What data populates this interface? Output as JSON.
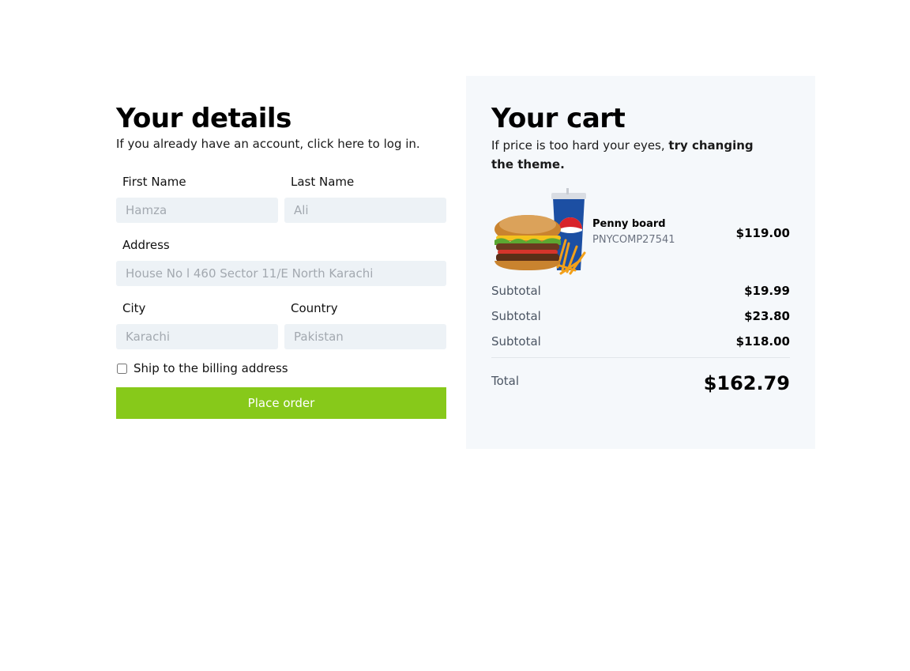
{
  "details": {
    "title": "Your details",
    "subtitle": "If you already have an account, click here to log in.",
    "first_name": {
      "label": "First Name",
      "placeholder": "Hamza"
    },
    "last_name": {
      "label": "Last Name",
      "placeholder": "Ali"
    },
    "address": {
      "label": "Address",
      "placeholder": "House No l 460 Sector 11/E North Karachi"
    },
    "city": {
      "label": "City",
      "placeholder": "Karachi"
    },
    "country": {
      "label": "Country",
      "placeholder": "Pakistan"
    },
    "ship_label": "Ship to the billing address",
    "ship_checked": false,
    "place_order_label": "Place order",
    "accent_color": "#87c91a"
  },
  "cart": {
    "title": "Your cart",
    "subtitle_plain": "If price is too hard your eyes,",
    "subtitle_bold": "try changing the theme.",
    "item": {
      "image": "burger-pepsi-fries-image",
      "name": "Penny board",
      "sku": "PNYCOMP27541",
      "price": "$119.00"
    },
    "lines": [
      {
        "label": "Subtotal",
        "value": "$19.99"
      },
      {
        "label": "Subtotal",
        "value": "$23.80"
      },
      {
        "label": "Subtotal",
        "value": "$118.00"
      }
    ],
    "total_label": "Total",
    "total_value": "$162.79",
    "background_color": "#f5f8fb"
  }
}
